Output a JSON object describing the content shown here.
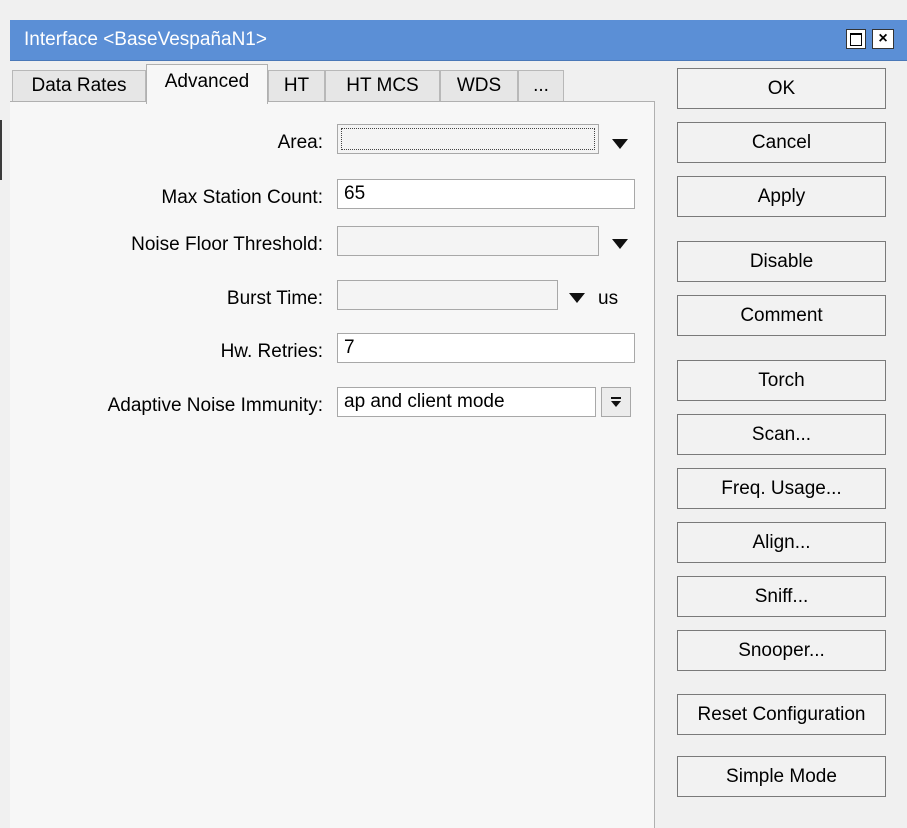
{
  "window": {
    "title": "Interface <BaseVespañaN1>",
    "maximize_glyph": "",
    "close_glyph": "×"
  },
  "tabs": [
    {
      "label": "Data Rates",
      "active": false
    },
    {
      "label": "Advanced",
      "active": true
    },
    {
      "label": "HT",
      "active": false
    },
    {
      "label": "HT MCS",
      "active": false
    },
    {
      "label": "WDS",
      "active": false
    },
    {
      "label": "...",
      "active": false
    }
  ],
  "form": {
    "area": {
      "label": "Area:",
      "value": ""
    },
    "max_station_count": {
      "label": "Max Station Count:",
      "value": "65"
    },
    "noise_floor_threshold": {
      "label": "Noise Floor Threshold:",
      "value": ""
    },
    "burst_time": {
      "label": "Burst Time:",
      "value": "",
      "unit": "us"
    },
    "hw_retries": {
      "label": "Hw. Retries:",
      "value": "7"
    },
    "adaptive_noise_immunity": {
      "label": "Adaptive Noise Immunity:",
      "value": "ap and client mode",
      "button_glyph": "🞃"
    }
  },
  "buttons": {
    "ok": "OK",
    "cancel": "Cancel",
    "apply": "Apply",
    "disable": "Disable",
    "comment": "Comment",
    "torch": "Torch",
    "scan": "Scan...",
    "freq_usage": "Freq. Usage...",
    "align": "Align...",
    "sniff": "Sniff...",
    "snooper": "Snooper...",
    "reset_configuration": "Reset Configuration",
    "simple_mode": "Simple Mode"
  },
  "colors": {
    "titlebar": "#5b8fd6",
    "window_bg": "#f0f0f0",
    "panel_bg": "#f7f7f7"
  },
  "icons": {
    "maximize": "maximize-icon",
    "close": "close-icon",
    "dropdown": "dropdown-arrow-icon"
  }
}
